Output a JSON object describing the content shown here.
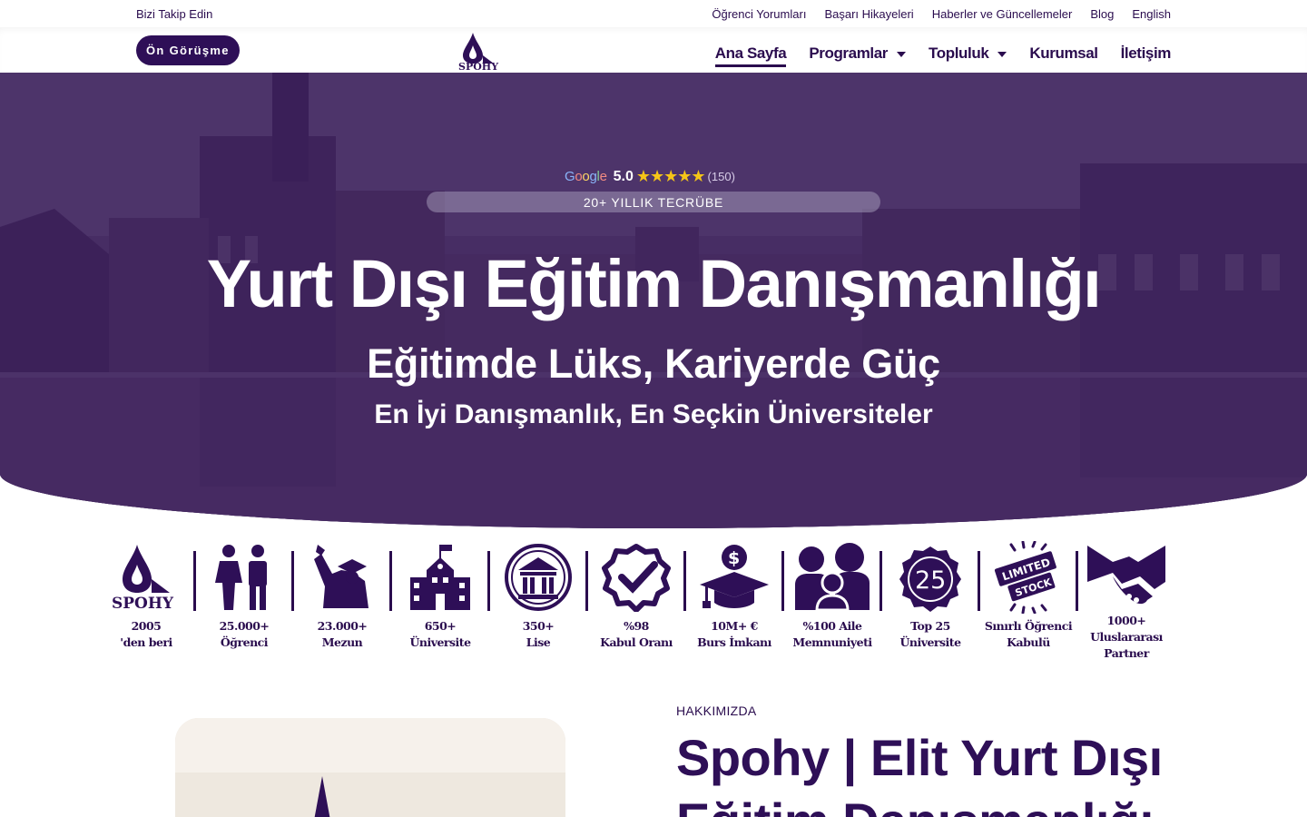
{
  "topbar": {
    "follow": "Bizi Takip Edin",
    "links": [
      "Öğrenci Yorumları",
      "Başarı Hikayeleri",
      "Haberler ve Güncellemeler",
      "Blog",
      "English"
    ]
  },
  "header": {
    "cta": "Ön Görüşme",
    "logo_text": "SPOHY",
    "nav": [
      {
        "label": "Ana Sayfa",
        "active": true
      },
      {
        "label": "Programlar",
        "dropdown": true
      },
      {
        "label": "Topluluk",
        "dropdown": true
      },
      {
        "label": "Kurumsal"
      },
      {
        "label": "İletişim"
      }
    ]
  },
  "hero": {
    "google": "Google",
    "rating": "5.0",
    "stars": "★★★★★",
    "reviews": "(150)",
    "badge": "20+ YILLIK TECRÜBE",
    "title": "Yurt Dışı Eğitim Danışmanlığı",
    "subtitle": "Eğitimde Lüks, Kariyerde Güç",
    "subtitle2": "En İyi Danışmanlık, En Seçkin Üniversiteler"
  },
  "stats": [
    {
      "line1": "2005",
      "line2": "'den beri",
      "icon": "spohy-logo-icon"
    },
    {
      "line1": "25.000+",
      "line2": "Öğrenci",
      "icon": "students-icon"
    },
    {
      "line1": "23.000+",
      "line2": "Mezun",
      "icon": "graduate-icon"
    },
    {
      "line1": "650+",
      "line2": "Üniversite",
      "icon": "university-building-icon"
    },
    {
      "line1": "350+",
      "line2": "Lise",
      "icon": "school-columns-icon"
    },
    {
      "line1": "%98",
      "line2": "Kabul Oranı",
      "icon": "check-badge-icon"
    },
    {
      "line1": "10M+ €",
      "line2": "Burs İmkanı",
      "icon": "scholarship-icon"
    },
    {
      "line1": "%100 Aile",
      "line2": "Memnuniyeti",
      "icon": "family-icon"
    },
    {
      "line1": "Top 25",
      "line2": "Üniversite",
      "icon": "top25-seal-icon"
    },
    {
      "line1": "Sınırlı Öğrenci",
      "line2": "Kabulü",
      "icon": "limited-stock-icon"
    },
    {
      "line1": "1000+ Uluslararası",
      "line2": "Partner",
      "icon": "handshake-icon"
    }
  ],
  "about": {
    "kicker": "HAKKIMIZDA",
    "title": "Spohy | Elit Yurt Dışı Eğitim Danışmanlığı"
  },
  "colors": {
    "brand": "#2e0f57",
    "hero_overlay": "#4a2f66",
    "star": "#f5c518"
  }
}
